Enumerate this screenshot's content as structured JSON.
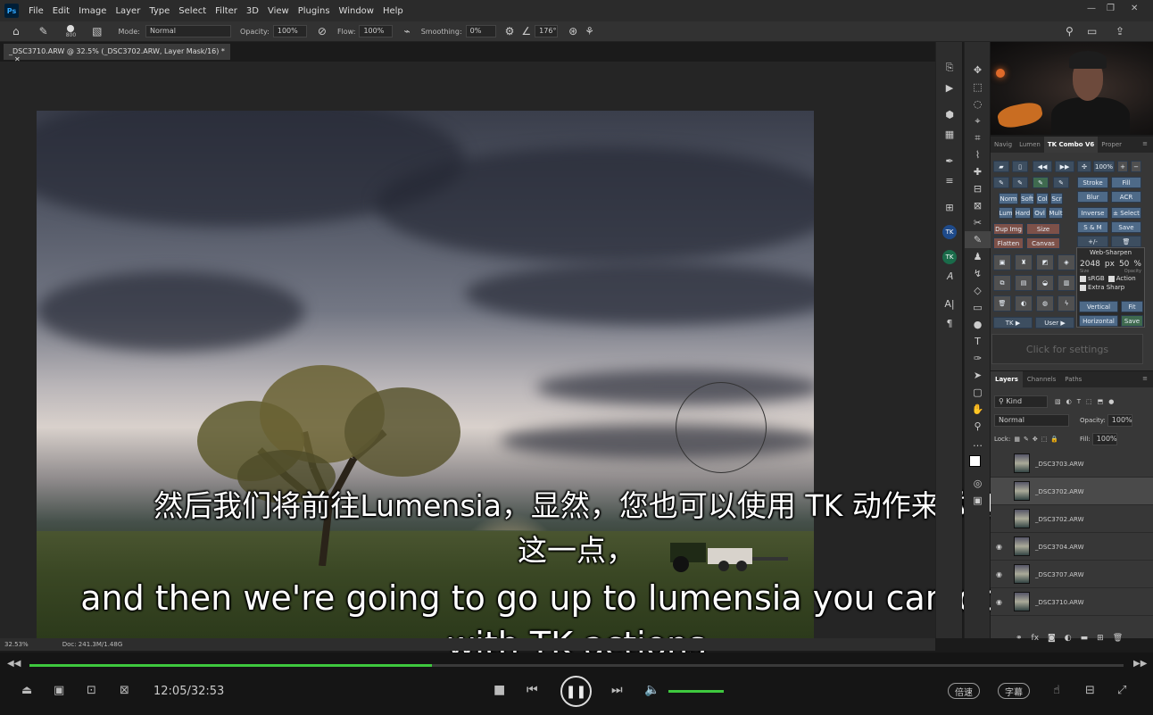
{
  "menubar": {
    "logo": "Ps",
    "items": [
      "File",
      "Edit",
      "Image",
      "Layer",
      "Type",
      "Select",
      "Filter",
      "3D",
      "View",
      "Plugins",
      "Window",
      "Help"
    ]
  },
  "options": {
    "brush_size": "800",
    "mode_label": "Mode:",
    "mode_value": "Normal",
    "opacity_label": "Opacity:",
    "opacity_value": "100%",
    "flow_label": "Flow:",
    "flow_value": "100%",
    "smoothing_label": "Smoothing:",
    "smoothing_value": "0%",
    "angle_value": "176°"
  },
  "document": {
    "tab_title": "_DSC3710.ARW @ 32.5% (_DSC3702.ARW, Layer Mask/16) *",
    "zoom": "32.53%",
    "doc_size": "Doc: 241.3M/1.48G"
  },
  "subtitles": {
    "cn_line1": "然后我们将前往Lumensia，显然，您也可以使用 TK 动作来做到",
    "cn_line2": "这一点，",
    "en_line1": "and then we're going to go up to lumensia you can do this",
    "en_line2": "with TK actions"
  },
  "tk_panel": {
    "tabs": [
      "Navig",
      "Lumen",
      "TK Combo V6",
      "Proper"
    ],
    "zoom_btn": "100%",
    "stroke": "Stroke",
    "fill": "Fill",
    "blur": "Blur",
    "acr": "ACR",
    "inverse": "Inverse",
    "select": "± Select",
    "sm": "S & M",
    "save": "Save",
    "blend": [
      "Norm",
      "Soft",
      "Col",
      "Scr"
    ],
    "blend2": [
      "Lum",
      "Hard",
      "Ovl",
      "Mult"
    ],
    "dup_img": "Dup Img",
    "size": "Size",
    "flatten": "Flatten",
    "canvas": "Canvas",
    "web_sharpen": "Web-Sharpen",
    "ws_px_value": "2048",
    "ws_px_unit": "px",
    "ws_pct_value": "50",
    "ws_pct_unit": "%",
    "ws_size_label": "Size",
    "ws_opacity_label": "Opacity",
    "srgb": "sRGB",
    "action": "Action",
    "extra_sharp": "Extra Sharp",
    "vertical": "Vertical",
    "fit": "Fit",
    "horizontal": "Horizontal",
    "save2": "Save",
    "tk_menu": "TK ▶",
    "user_menu": "User ▶",
    "click_settings": "Click for settings"
  },
  "layers": {
    "tabs": [
      "Layers",
      "Channels",
      "Paths"
    ],
    "filter_kind": "Kind",
    "blend_mode": "Normal",
    "opacity_label": "Opacity:",
    "opacity_value": "100%",
    "lock_label": "Lock:",
    "fill_label": "Fill:",
    "fill_value": "100%",
    "rows": [
      {
        "name": "_DSC3703.ARW"
      },
      {
        "name": "_DSC3702.ARW"
      },
      {
        "name": "_DSC3702.ARW"
      },
      {
        "name": "_DSC3704.ARW"
      },
      {
        "name": "_DSC3707.ARW"
      },
      {
        "name": "_DSC3710.ARW"
      }
    ]
  },
  "player": {
    "time": "12:05/32:53",
    "progress_fraction": 0.368,
    "speed_btn": "倍速",
    "subtitle_btn": "字幕",
    "accent": "#3ec83e"
  }
}
